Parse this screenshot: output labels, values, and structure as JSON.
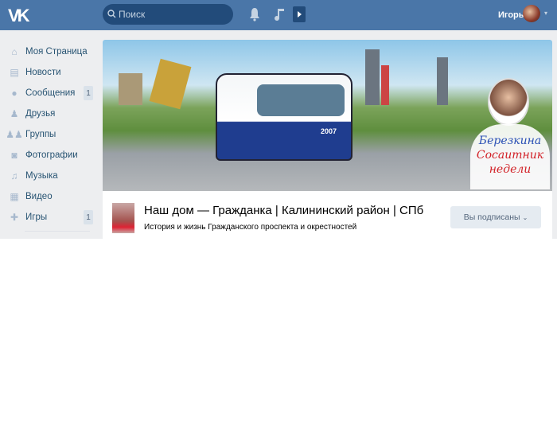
{
  "header": {
    "logo": "VK",
    "search_placeholder": "Поиск",
    "user_name": "Игорь",
    "icons": [
      "bell-icon",
      "music-note-icon",
      "play-icon"
    ]
  },
  "sidebar": {
    "items": [
      {
        "label": "Моя Страница",
        "icon": "home-icon",
        "glyph": "⌂"
      },
      {
        "label": "Новости",
        "icon": "news-icon",
        "glyph": "▤"
      },
      {
        "label": "Сообщения",
        "icon": "message-icon",
        "glyph": "●",
        "count": "1"
      },
      {
        "label": "Друзья",
        "icon": "friend-icon",
        "glyph": "♟"
      },
      {
        "label": "Группы",
        "icon": "groups-icon",
        "glyph": "♟♟"
      },
      {
        "label": "Фотографии",
        "icon": "camera-icon",
        "glyph": "◙"
      },
      {
        "label": "Музыка",
        "icon": "music-icon",
        "glyph": "♫"
      },
      {
        "label": "Видео",
        "icon": "video-icon",
        "glyph": "▦"
      },
      {
        "label": "Игры",
        "icon": "gamepad-icon",
        "glyph": "✚",
        "count": "1"
      }
    ]
  },
  "group": {
    "title": "Наш дом — Гражданка | Калининский район | СПб",
    "subtitle": "История и жизнь Гражданского проспекта и окрестностей",
    "subscribe_button": "Вы подписаны",
    "cover_text": [
      "Березкина",
      "Сосаитник",
      "недели"
    ],
    "bus_number": "2007"
  },
  "colors": {
    "header": "#4a76a8",
    "search": "#224b7a",
    "link": "#285473"
  }
}
